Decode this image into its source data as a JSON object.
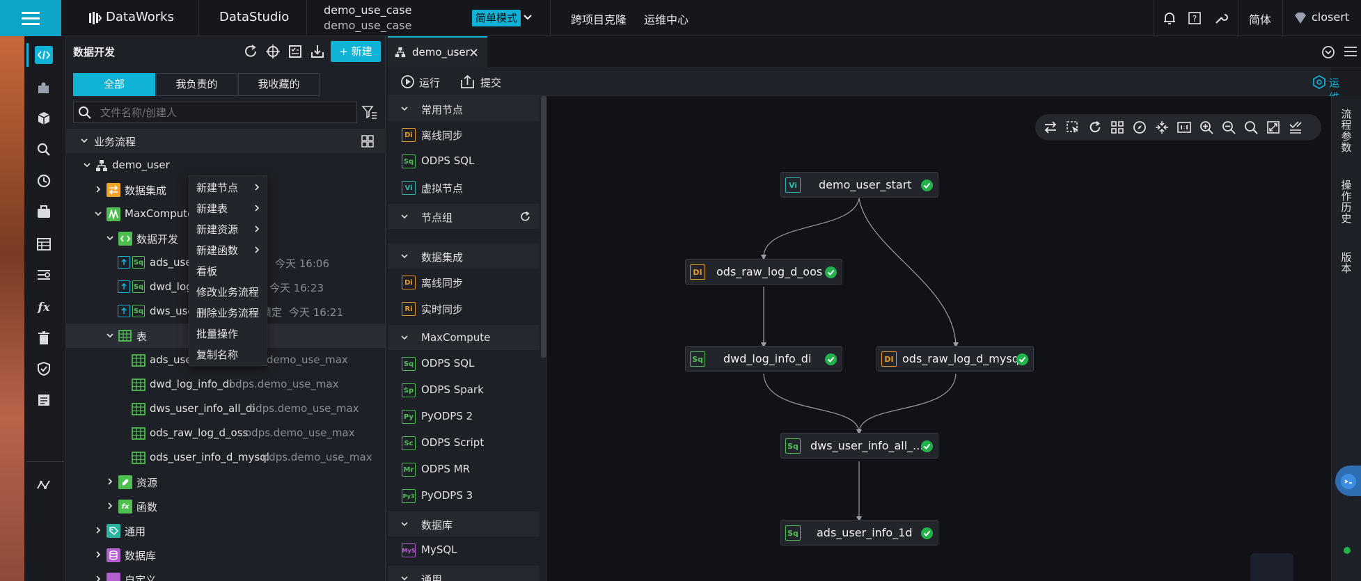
{
  "header": {
    "brand": "DataWorks",
    "studio": "DataStudio",
    "workspace_name": "demo_use_case",
    "workspace_sub": "demo_use_case",
    "mode": "简单模式",
    "link_clone": "跨项目克隆",
    "link_ops": "运维中心",
    "lang": "简体",
    "user": "closert"
  },
  "explorer": {
    "title": "数据开发",
    "new_button": "+ 新建",
    "filter_tabs": [
      "全部",
      "我负责的",
      "我收藏的"
    ],
    "search_placeholder": "文件名称/创建人",
    "section": "业务流程",
    "tree": {
      "flow": "demo_user",
      "data_integration": "数据集成",
      "maxcompute": "MaxCompute",
      "data_dev": "数据开发",
      "dev_items": [
        {
          "name": "ads_user",
          "time": "今天 16:06"
        },
        {
          "name": "dwd_log",
          "time": "今天 16:23"
        },
        {
          "name": "dws_use",
          "status": "锁定",
          "time": "今天 16:21"
        }
      ],
      "tables_folder": "表",
      "tables": [
        {
          "name": "ads_use",
          "db": "demo_use_max"
        },
        {
          "name": "dwd_log_info_di",
          "db": "odps.demo_use_max"
        },
        {
          "name": "dws_user_info_all_di",
          "db": "odps.demo_use_max"
        },
        {
          "name": "ods_raw_log_d_oss",
          "db": "odps.demo_use_max"
        },
        {
          "name": "ods_user_info_d_mysql",
          "db": "odps.demo_use_max"
        }
      ],
      "resources": "资源",
      "functions": "函数",
      "general": "通用",
      "database": "数据库",
      "custom": "自定义"
    }
  },
  "context_menu": {
    "items": [
      "新建节点",
      "新建表",
      "新建资源",
      "新建函数",
      "看板",
      "修改业务流程",
      "删除业务流程",
      "批量操作",
      "复制名称"
    ]
  },
  "editor": {
    "tab_label": "demo_user",
    "run": "运行",
    "submit": "提交",
    "ops": "运维"
  },
  "node_panel": {
    "common_head": "常用节点",
    "common_items": [
      {
        "badge": "Di",
        "label": "离线同步"
      },
      {
        "badge": "Sq",
        "label": "ODPS SQL"
      },
      {
        "badge": "Vi",
        "label": "虚拟节点"
      }
    ],
    "group_head": "节点组",
    "integration_head": "数据集成",
    "integration_items": [
      {
        "badge": "Di",
        "label": "离线同步"
      },
      {
        "badge": "Ri",
        "label": "实时同步"
      }
    ],
    "maxcompute_head": "MaxCompute",
    "maxcompute_items": [
      {
        "badge": "Sq",
        "label": "ODPS SQL"
      },
      {
        "badge": "Sp",
        "label": "ODPS Spark"
      },
      {
        "badge": "Py",
        "label": "PyODPS 2"
      },
      {
        "badge": "Sc",
        "label": "ODPS Script"
      },
      {
        "badge": "Mr",
        "label": "ODPS MR"
      },
      {
        "badge": "Py3",
        "label": "PyODPS 3"
      }
    ],
    "database_head": "数据库",
    "database_items": [
      {
        "badge": "MyS",
        "label": "MySQL"
      }
    ],
    "general_head": "通用"
  },
  "dag": {
    "nodes": [
      {
        "badge": "Vi",
        "label": "demo_user_start"
      },
      {
        "badge": "DI",
        "label": "ods_raw_log_d_oos"
      },
      {
        "badge": "Sq",
        "label": "dwd_log_info_di"
      },
      {
        "badge": "DI",
        "label": "ods_raw_log_d_mysql"
      },
      {
        "badge": "Sq",
        "label": "dws_user_info_all_..."
      },
      {
        "badge": "Sq",
        "label": "ads_user_info_1d"
      }
    ]
  },
  "right_rail": {
    "flow_params": "流程参数",
    "op_history": "操作历史",
    "version": "版本"
  },
  "colors": {
    "accent": "#10b3d6",
    "success": "#21b24a",
    "sql_green": "#4fbf52",
    "di_orange": "#e59a2b",
    "vi_teal": "#31b6a8"
  }
}
